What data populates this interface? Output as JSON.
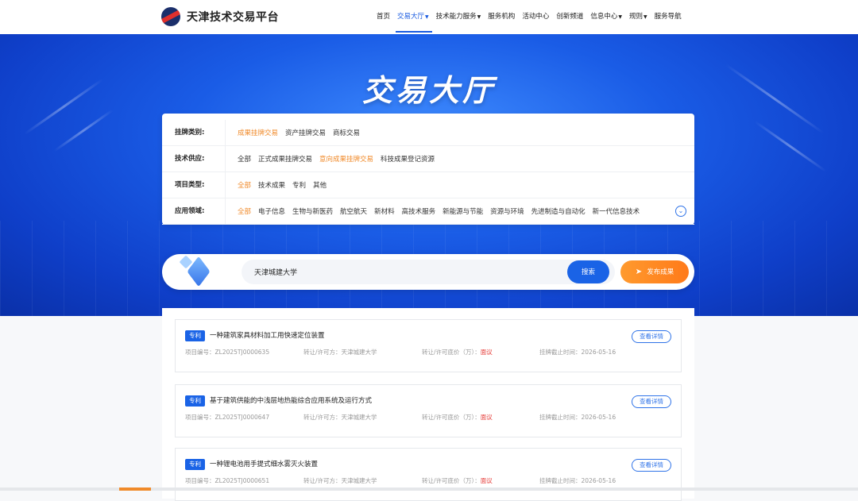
{
  "header": {
    "site_name": "天津技术交易平台",
    "nav": [
      {
        "label": "首页",
        "dropdown": false,
        "active": false
      },
      {
        "label": "交易大厅",
        "dropdown": true,
        "active": true
      },
      {
        "label": "技术能力服务",
        "dropdown": true,
        "active": false
      },
      {
        "label": "服务机构",
        "dropdown": false,
        "active": false
      },
      {
        "label": "活动中心",
        "dropdown": false,
        "active": false
      },
      {
        "label": "创新频道",
        "dropdown": false,
        "active": false
      },
      {
        "label": "信息中心",
        "dropdown": true,
        "active": false
      },
      {
        "label": "规则",
        "dropdown": true,
        "active": false
      },
      {
        "label": "服务导航",
        "dropdown": false,
        "active": false
      }
    ]
  },
  "banner": {
    "title": "交易大厅"
  },
  "filters": [
    {
      "label": "挂牌类别:",
      "options": [
        "成果挂牌交易",
        "资产挂牌交易",
        "商标交易"
      ],
      "selected": 0
    },
    {
      "label": "技术供应:",
      "options": [
        "全部",
        "正式成果挂牌交易",
        "意向成果挂牌交易",
        "科技成果登记资源"
      ],
      "selected": 2
    },
    {
      "label": "项目类型:",
      "options": [
        "全部",
        "技术成果",
        "专利",
        "其他"
      ],
      "selected": 0
    },
    {
      "label": "应用领域:",
      "options": [
        "全部",
        "电子信息",
        "生物与新医药",
        "航空航天",
        "新材料",
        "高技术服务",
        "新能源与节能",
        "资源与环境",
        "先进制造与自动化",
        "新一代信息技术"
      ],
      "selected": 0
    }
  ],
  "search": {
    "value": "天津城建大学",
    "search_label": "搜索",
    "publish_label": "发布成果"
  },
  "items": [
    {
      "tag": "专利",
      "title": "一种建筑家具材料加工用快速定位装置",
      "project_no_label": "项目编号：",
      "project_no": "ZL2025TJ0000635",
      "party_label": "转让/许可方：",
      "party": "天津城建大学",
      "price_label": "转让/许可底价（万）：",
      "price": "面议",
      "deadline_label": "挂牌截止时间：",
      "deadline": "2026-05-16",
      "detail_label": "查看详情"
    },
    {
      "tag": "专利",
      "title": "基于建筑供能的中浅层地热能综合应用系统及运行方式",
      "project_no_label": "项目编号：",
      "project_no": "ZL2025TJ0000647",
      "party_label": "转让/许可方：",
      "party": "天津城建大学",
      "price_label": "转让/许可底价（万）：",
      "price": "面议",
      "deadline_label": "挂牌截止时间：",
      "deadline": "2026-05-16",
      "detail_label": "查看详情"
    },
    {
      "tag": "专利",
      "title": "一种锂电池用手提式细水雾灭火装置",
      "project_no_label": "项目编号：",
      "project_no": "ZL2025TJ0000651",
      "party_label": "转让/许可方：",
      "party": "天津城建大学",
      "price_label": "转让/许可底价（万）：",
      "price": "面议",
      "deadline_label": "挂牌截止时间：",
      "deadline": "2026-05-16",
      "detail_label": "查看详情"
    }
  ],
  "colors": {
    "accent": "#1a63e6",
    "selected_option": "#f08a2a",
    "price_red": "#e53935"
  }
}
